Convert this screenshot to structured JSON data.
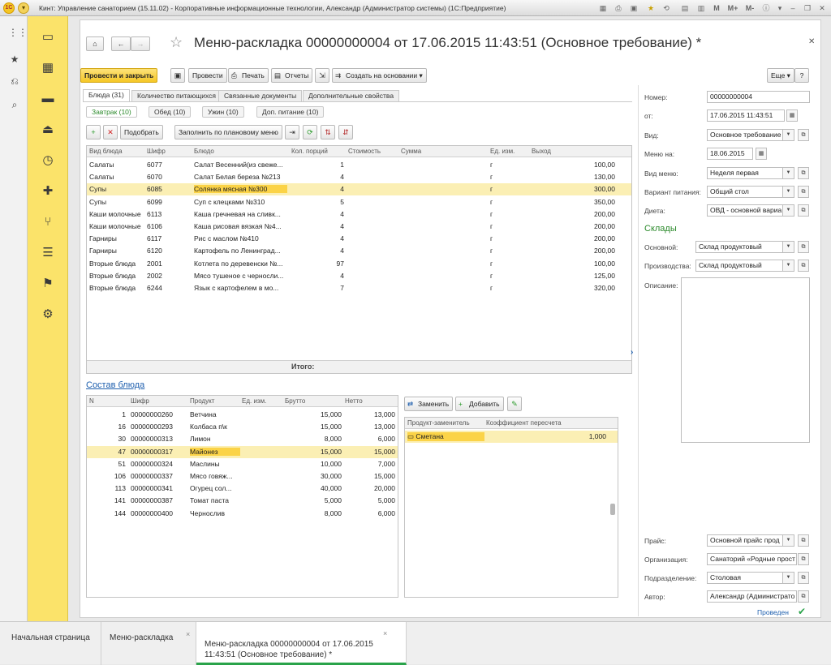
{
  "window": {
    "title": "Кинт: Управление санаторием (15.11.02) - Корпоративные информационные технологии, Александр (Администратор системы)   (1С:Предприятие)",
    "logo": "1С"
  },
  "titlebar_buttons": {
    "m": "M",
    "mplus": "M+",
    "mminus": "M-"
  },
  "form": {
    "title": "Меню-раскладка 00000000004 от 17.06.2015 11:43:51 (Основное требование) *"
  },
  "toolbar": {
    "post_close": "Провести и закрыть",
    "post": "Провести",
    "print": "Печать",
    "reports": "Отчеты",
    "create_based": "Создать на основании",
    "more": "Еще",
    "help": "?"
  },
  "tabs": [
    {
      "label": "Блюда (31)"
    },
    {
      "label": "Количество питающихся"
    },
    {
      "label": "Связанные документы"
    },
    {
      "label": "Дополнительные свойства"
    }
  ],
  "subtabs": [
    {
      "label": "Завтрак (10)"
    },
    {
      "label": "Обед (10)"
    },
    {
      "label": "Ужин (10)"
    },
    {
      "label": "Доп. питание (10)"
    }
  ],
  "dish_toolbar": {
    "pick": "Подобрать",
    "fill": "Заполнить по плановому меню"
  },
  "dishes": {
    "columns": {
      "type": "Вид блюда",
      "code": "Шифр",
      "dish": "Блюдо",
      "portions": "Кол. порций",
      "cost": "Стоимость",
      "sum": "Сумма",
      "unit": "Ед. изм.",
      "yield": "Выход"
    },
    "total_label": "Итого:",
    "rows": [
      {
        "type": "Салаты",
        "code": "6077",
        "dish": "Салат Весенний(из свеже...",
        "portions": "1",
        "unit": "г",
        "yield": "100,00"
      },
      {
        "type": "Салаты",
        "code": "6070",
        "dish": "Салат Белая береза №213",
        "portions": "4",
        "unit": "г",
        "yield": "130,00"
      },
      {
        "type": "Супы",
        "code": "6085",
        "dish": "Солянка мясная №300",
        "portions": "4",
        "unit": "г",
        "yield": "300,00"
      },
      {
        "type": "Супы",
        "code": "6099",
        "dish": "Суп с клецками №310",
        "portions": "5",
        "unit": "г",
        "yield": "350,00"
      },
      {
        "type": "Каши молочные",
        "code": "6113",
        "dish": "Каша гречневая на сливк...",
        "portions": "4",
        "unit": "г",
        "yield": "200,00"
      },
      {
        "type": "Каши молочные",
        "code": "6106",
        "dish": "Каша рисовая вязкая №4...",
        "portions": "4",
        "unit": "г",
        "yield": "200,00"
      },
      {
        "type": "Гарниры",
        "code": "6117",
        "dish": "Рис с маслом №410",
        "portions": "4",
        "unit": "г",
        "yield": "200,00"
      },
      {
        "type": "Гарниры",
        "code": "6120",
        "dish": "Картофель по Ленинград...",
        "portions": "4",
        "unit": "г",
        "yield": "200,00"
      },
      {
        "type": "Вторые блюда",
        "code": "2001",
        "dish": "Котлета по деревенски №...",
        "portions": "97",
        "unit": "г",
        "yield": "100,00"
      },
      {
        "type": "Вторые блюда",
        "code": "2002",
        "dish": "Мясо тушеное с черносли...",
        "portions": "4",
        "unit": "г",
        "yield": "125,00"
      },
      {
        "type": "Вторые блюда",
        "code": "6244",
        "dish": "Язык с картофелем в мо...",
        "portions": "7",
        "unit": "г",
        "yield": "320,00"
      }
    ]
  },
  "composition": {
    "title": "Состав блюда",
    "columns": {
      "n": "N",
      "code": "Шифр",
      "product": "Продукт",
      "unit": "Ед. изм.",
      "gross": "Брутто",
      "net": "Нетто"
    },
    "rows": [
      {
        "n": "1",
        "code": "00000000260",
        "product": "Ветчина",
        "gross": "15,000",
        "net": "13,000"
      },
      {
        "n": "16",
        "code": "00000000293",
        "product": "Колбаса п\\к",
        "gross": "15,000",
        "net": "13,000"
      },
      {
        "n": "30",
        "code": "00000000313",
        "product": "Лимон",
        "gross": "8,000",
        "net": "6,000"
      },
      {
        "n": "47",
        "code": "00000000317",
        "product": "Майонез",
        "gross": "15,000",
        "net": "15,000"
      },
      {
        "n": "51",
        "code": "00000000324",
        "product": "Маслины",
        "gross": "10,000",
        "net": "7,000"
      },
      {
        "n": "106",
        "code": "00000000337",
        "product": "Мясо говяж...",
        "gross": "30,000",
        "net": "15,000"
      },
      {
        "n": "113",
        "code": "00000000341",
        "product": "Огурец сол...",
        "gross": "40,000",
        "net": "20,000"
      },
      {
        "n": "141",
        "code": "00000000387",
        "product": "Томат паста",
        "gross": "5,000",
        "net": "5,000"
      },
      {
        "n": "144",
        "code": "00000000400",
        "product": "Чернослив",
        "gross": "8,000",
        "net": "6,000"
      }
    ]
  },
  "substitutes": {
    "replace": "Заменить",
    "add": "Добавить",
    "columns": {
      "product": "Продукт-заменитель",
      "coef": "Коэффициент пересчета"
    },
    "rows": [
      {
        "product": "Сметана",
        "coef": "1,000"
      }
    ]
  },
  "right": {
    "number_label": "Номер:",
    "number": "00000000004",
    "date_label": "от:",
    "date": "17.06.2015 11:43:51",
    "kind_label": "Вид:",
    "kind": "Основное требование",
    "menu_on_label": "Меню на:",
    "menu_on": "18.06.2015",
    "menu_kind_label": "Вид меню:",
    "menu_kind": "Неделя первая",
    "meal_label": "Вариант питания:",
    "meal": "Общий стол",
    "diet_label": "Диета:",
    "diet": "ОВД - основной вариа",
    "warehouses": "Склады",
    "main_wh_label": "Основной:",
    "main_wh": "Склад продуктовый",
    "prod_wh_label": "Производства:",
    "prod_wh": "Склад продуктовый",
    "desc_label": "Описание:",
    "price_label": "Прайс:",
    "price": "Основной прайс прод",
    "org_label": "Организация:",
    "org": "Санаторий «Родные прост",
    "dept_label": "Подразделение:",
    "dept": "Столовая",
    "author_label": "Автор:",
    "author": "Александр (Администрато",
    "status": "Проведен"
  },
  "bottom_tabs": [
    {
      "label": "Начальная страница"
    },
    {
      "label": "Меню-раскладка"
    },
    {
      "label": "Меню-раскладка 00000000004 от 17.06.2015\n11:43:51 (Основное требование) *"
    }
  ]
}
